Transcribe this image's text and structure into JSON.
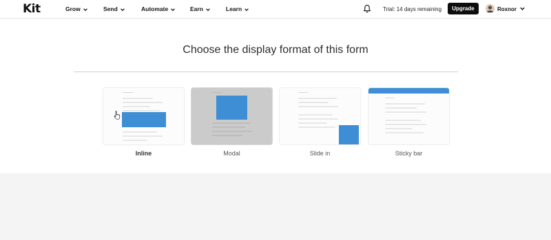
{
  "header": {
    "logo": "Kit",
    "nav": [
      {
        "label": "Grow"
      },
      {
        "label": "Send"
      },
      {
        "label": "Automate"
      },
      {
        "label": "Earn"
      },
      {
        "label": "Learn"
      }
    ],
    "trial_text": "Trial: 14 days remaining",
    "upgrade_label": "Upgrade",
    "user_name": "Roxnor"
  },
  "main": {
    "title": "Choose the display format of this form",
    "formats": [
      {
        "label": "Inline",
        "selected": true
      },
      {
        "label": "Modal",
        "selected": false
      },
      {
        "label": "Slide in",
        "selected": false
      },
      {
        "label": "Sticky bar",
        "selected": false
      }
    ]
  },
  "colors": {
    "accent_blue": "#3d8ed4",
    "upgrade_bg": "#0d0d0d"
  },
  "icons": [
    "bell-icon",
    "chevron-down-icon",
    "avatar",
    "cursor-icon"
  ]
}
